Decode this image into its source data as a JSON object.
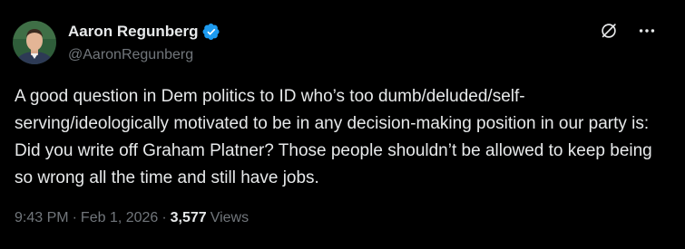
{
  "author": {
    "display_name": "Aaron Regunberg",
    "handle": "@AaronRegunberg",
    "verified_color": "#1d9bf0"
  },
  "tweet": {
    "text": "A good question in Dem politics to ID who’s too dumb/deluded/self-serving/ideologically motivated to be in any decision-making position in our party is: Did you write off Graham Platner? Those people shouldn’t be allowed to keep being so wrong all the time and still have jobs.",
    "time": "9:43 PM",
    "separator": "·",
    "date": "Feb 1, 2026",
    "views_count": "3,577",
    "views_label": "Views"
  },
  "icons": {
    "grok": "grok-icon",
    "more": "more-options-icon",
    "verified": "verified-badge-icon"
  },
  "colors": {
    "background": "#000000",
    "text_primary": "#e7e9ea",
    "text_secondary": "#71767b",
    "accent": "#1d9bf0"
  }
}
